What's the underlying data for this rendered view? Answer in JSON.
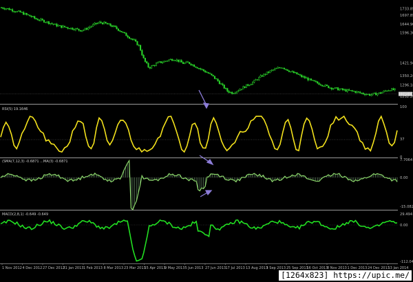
{
  "chart_data": [
    {
      "type": "candlestick",
      "panel": "price",
      "title": "",
      "ylabels": [
        "1733.85",
        "1697.85",
        "1644.96",
        "1596.36",
        "1421.94",
        "1350.24",
        "1296.18",
        "1232.26"
      ],
      "ylim": [
        1200,
        1760
      ],
      "close_trend": [
        1740,
        1735,
        1728,
        1718,
        1712,
        1700,
        1690,
        1675,
        1668,
        1660,
        1650,
        1640,
        1632,
        1628,
        1622,
        1618,
        1610,
        1615,
        1630,
        1645,
        1655,
        1650,
        1640,
        1628,
        1610,
        1590,
        1570,
        1550,
        1520,
        1440,
        1395,
        1410,
        1425,
        1430,
        1440,
        1445,
        1435,
        1420,
        1425,
        1410,
        1395,
        1380,
        1365,
        1345,
        1320,
        1290,
        1260,
        1250,
        1265,
        1280,
        1295,
        1310,
        1330,
        1350,
        1365,
        1380,
        1390,
        1400,
        1385,
        1370,
        1360,
        1345,
        1335,
        1320,
        1310,
        1300,
        1290,
        1280,
        1275,
        1270,
        1265,
        1262,
        1258,
        1250,
        1245,
        1240,
        1245,
        1250,
        1262,
        1270,
        1268
      ],
      "current_price": 1245
    },
    {
      "type": "line",
      "panel": "rsi",
      "title": "RSI(5) 19.1646",
      "ylabels": [
        "100",
        "37",
        "0"
      ],
      "levels": [
        37
      ],
      "ylim": [
        0,
        100
      ]
    },
    {
      "type": "line",
      "panel": "ma-diff",
      "title": "(SMA(7,12,3) -0.6871 ...MA(3) -0.6871",
      "ylabels": [
        "7.7064",
        "0.00",
        "-15.0824"
      ],
      "ylim": [
        -15.08,
        7.71
      ]
    },
    {
      "type": "line",
      "panel": "macd",
      "title": "MACD(2,8,1) -0.649 -0.649",
      "ylabels": [
        "29.494",
        "0.00",
        "-112.046"
      ],
      "ylim": [
        -112.05,
        29.49
      ]
    }
  ],
  "x_axis_labels": [
    "1 Nov 2012",
    "4 Dec 2012",
    "27 Dec 2012",
    "31 Jan 2013",
    "1 Feb 2013",
    "8 Mar 2013",
    "23 Mar 2013",
    "15 Apr 2013",
    "9 May 2013",
    "5 Jun 2013",
    "27 Jun 2013",
    "17 Jul 2013",
    "13 Aug 2013",
    "3 Sep 2013",
    "25 Sep 2013",
    "16 Oct 2013",
    "8 Nov 2013",
    "1 Dec 2013",
    "24 Dec 2013",
    "13 Jan 2014"
  ],
  "watermark": "[1264x823] https://upic.me/",
  "colors": {
    "candle": "#2ad42a",
    "rsi": "#f4e21c",
    "ma": "#8ad66a",
    "macd": "#22e022",
    "arrow": "#8c7cd8",
    "grid": "#3a3a3a",
    "separator": "#9a9a9a"
  }
}
